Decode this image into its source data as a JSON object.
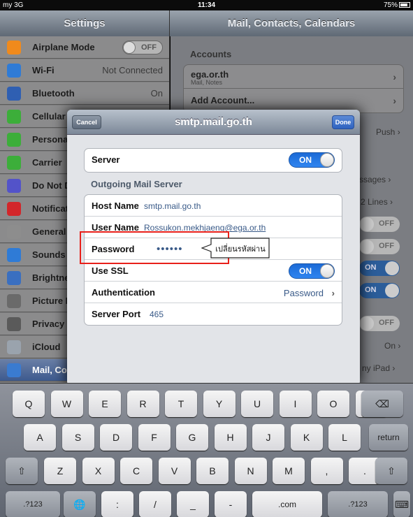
{
  "status_bar": {
    "carrier": "my 3G",
    "time": "11:34",
    "battery": "75%"
  },
  "left_nav": {
    "title": "Settings"
  },
  "right_nav": {
    "title": "Mail, Contacts, Calendars"
  },
  "settings_items": [
    {
      "label": "Airplane Mode",
      "icon": "airplane-icon",
      "color": "#f08a1c",
      "value": "OFF",
      "kind": "switch"
    },
    {
      "label": "Wi-Fi",
      "icon": "wifi-icon",
      "color": "#2f7bd6",
      "value": "Not Connected",
      "kind": "text"
    },
    {
      "label": "Bluetooth",
      "icon": "bluetooth-icon",
      "color": "#2f5fb2",
      "value": "On",
      "kind": "text"
    },
    {
      "label": "Cellular D",
      "icon": "cellular-icon",
      "color": "#3cae3a",
      "value": "",
      "kind": "none"
    },
    {
      "label": "Persona",
      "icon": "personal-hotspot-icon",
      "color": "#3cae3a",
      "value": "",
      "kind": "none"
    },
    {
      "label": "Carrier",
      "icon": "carrier-icon",
      "color": "#3cae3a",
      "value": "",
      "kind": "none"
    },
    {
      "label": "Do Not D",
      "icon": "moon-icon",
      "color": "#5353c9",
      "value": "",
      "kind": "none"
    },
    {
      "label": "Notificat",
      "icon": "notifications-icon",
      "color": "#d2262a",
      "value": "",
      "kind": "none"
    },
    {
      "label": "General",
      "icon": "gear-icon",
      "color": "#8d8d8d",
      "value": "",
      "kind": "none"
    },
    {
      "label": "Sounds",
      "icon": "speaker-icon",
      "color": "#2f7bd6",
      "value": "",
      "kind": "none"
    },
    {
      "label": "Brightne",
      "icon": "brightness-icon",
      "color": "#3a6fc0",
      "value": "",
      "kind": "none"
    },
    {
      "label": "Picture F",
      "icon": "picture-frame-icon",
      "color": "#6a6a6a",
      "value": "",
      "kind": "none"
    },
    {
      "label": "Privacy",
      "icon": "hand-icon",
      "color": "#5a5a5a",
      "value": "",
      "kind": "none"
    },
    {
      "label": "iCloud",
      "icon": "cloud-icon",
      "color": "#9aa3ad",
      "value": "",
      "kind": "none"
    },
    {
      "label": "Mail, Co",
      "icon": "mail-icon",
      "color": "#3a7bd0",
      "value": "",
      "kind": "none",
      "selected": true
    }
  ],
  "accounts": {
    "section_label": "Accounts",
    "account_name": "ega.or.th",
    "account_sub": "Mail, Notes",
    "add_account": "Add Account..."
  },
  "right_fragments": {
    "push": "Push",
    "messages": "ssages",
    "lines": "2 Lines",
    "off1": "OFF",
    "off2": "OFF",
    "on1": "ON",
    "on2": "ON",
    "off3": "OFF",
    "on_text": "On",
    "ipad": "ny iPad"
  },
  "modal": {
    "title": "smtp.mail.go.th",
    "cancel": "Cancel",
    "done": "Done",
    "server_label": "Server",
    "server_switch": "ON",
    "outgoing_label": "Outgoing Mail Server",
    "host_label": "Host Name",
    "host_value": "smtp.mail.go.th",
    "user_label": "User Name",
    "user_value": "Rossukon.mekhjaeng@ega.or.th",
    "password_label": "Password",
    "password_value": "••••••",
    "ssl_label": "Use SSL",
    "ssl_switch": "ON",
    "auth_label": "Authentication",
    "auth_value": "Password",
    "port_label": "Server Port",
    "port_value": "465"
  },
  "callout": {
    "text": "เปลี่ยนรหัสผ่าน"
  },
  "keyboard": {
    "row1": [
      "Q",
      "W",
      "E",
      "R",
      "T",
      "Y",
      "U",
      "I",
      "O",
      "P"
    ],
    "backspace": "⌫",
    "row2": [
      "A",
      "S",
      "D",
      "F",
      "G",
      "H",
      "J",
      "K",
      "L"
    ],
    "return": "return",
    "shift": "⇧",
    "row3": [
      "Z",
      "X",
      "C",
      "V",
      "B",
      "N",
      "M",
      ",",
      "."
    ],
    "row4": [
      ".?123",
      "🌐",
      ":",
      "/",
      "_",
      "-",
      ".com",
      ".?123"
    ],
    "hide_keyboard": "⌨"
  }
}
